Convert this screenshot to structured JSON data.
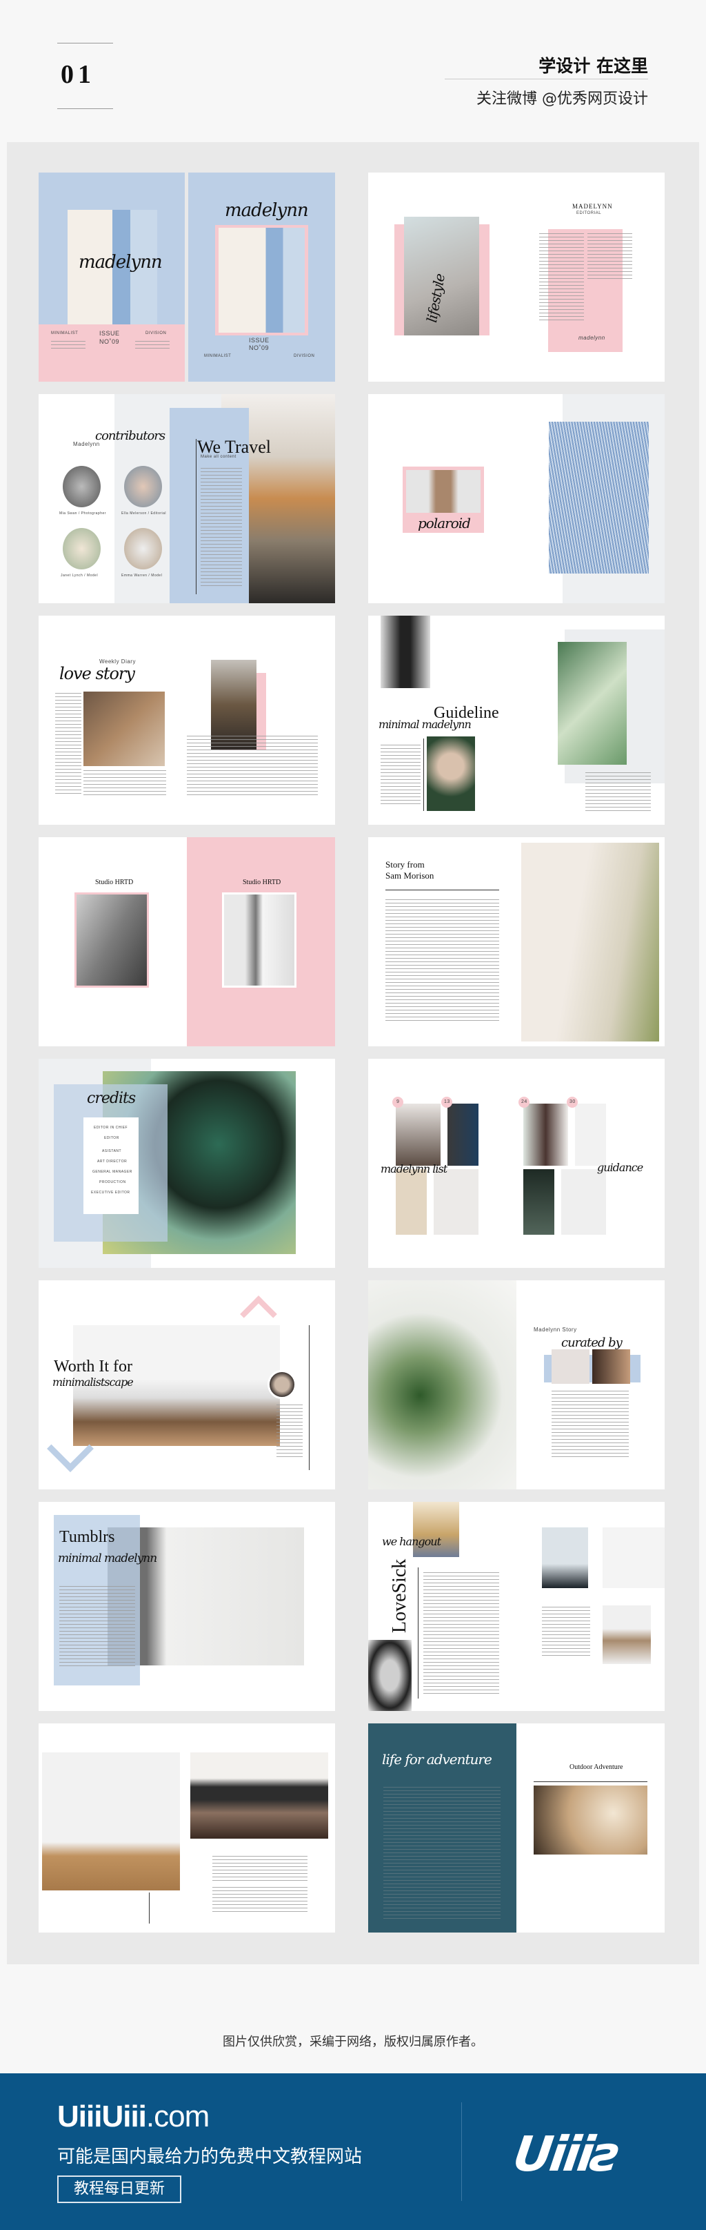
{
  "header": {
    "number": "01",
    "title": "学设计 在这里",
    "subtitle": "关注微博 @优秀网页设计"
  },
  "spreads": {
    "s1": {
      "script": "madelynn",
      "issue": "ISSUE",
      "issue_no": "NO˚09",
      "left_col": "MINIMALIST",
      "right_col": "DIVISION"
    },
    "s2": {
      "brand": "MADELYNN",
      "sub": "EDITORIAL",
      "script": "lifestyle",
      "signature": "madelynn"
    },
    "s3": {
      "label": "Madelynn",
      "script": "contributors",
      "title": "We Travel",
      "tagline": "Make all content",
      "people": [
        "Mia Swan / Photographer",
        "Ella Melerson / Editorial",
        "Janet Lynch / Model",
        "Emma Warren / Model"
      ]
    },
    "s4": {
      "script": "polaroid"
    },
    "s5": {
      "label": "Weekly Diary",
      "script": "love story"
    },
    "s6": {
      "script": "minimal madelynn",
      "title": "Guideline"
    },
    "s7": {
      "title": "Studio HRTD"
    },
    "s8": {
      "title_line1": "Story from",
      "title_line2": "Sam Morison"
    },
    "s9": {
      "script": "credits",
      "roles": [
        "EDITOR IN CHIEF",
        "EDITOR",
        "ASISTANT",
        "ART DIRECTOR",
        "GENERAL MANAGER",
        "PRODUCTION",
        "EXECUTIVE EDITOR"
      ]
    },
    "s10": {
      "numbers": [
        "9",
        "13",
        "24",
        "30"
      ],
      "script_left": "madelynn list",
      "script_right": "guidance"
    },
    "s11": {
      "title": "Worth It for",
      "script": "minimalistscape"
    },
    "s12": {
      "label": "Madelynn Story",
      "script": "curated by"
    },
    "s13": {
      "title": "Tumblrs",
      "script": "minimal madelynn"
    },
    "s14": {
      "script": "we hangout",
      "title": "LoveSick"
    },
    "s16": {
      "script": "life for adventure",
      "title": "Outdoor Adventure"
    }
  },
  "caption": "图片仅供欣赏，采编于网络，版权归属原作者。",
  "footer": {
    "brand_bold": "UiiiUiii",
    "brand_suffix": ".com",
    "tagline": "可能是国内最给力的免费中文教程网站",
    "badge": "教程每日更新",
    "logo": "Uiiiƨ"
  },
  "colors": {
    "panel": "#e9e9e9",
    "footer": "#0b5587",
    "pink": "#f6c9cf",
    "blue": "#bccfe6",
    "teal": "#2f5b6b"
  }
}
